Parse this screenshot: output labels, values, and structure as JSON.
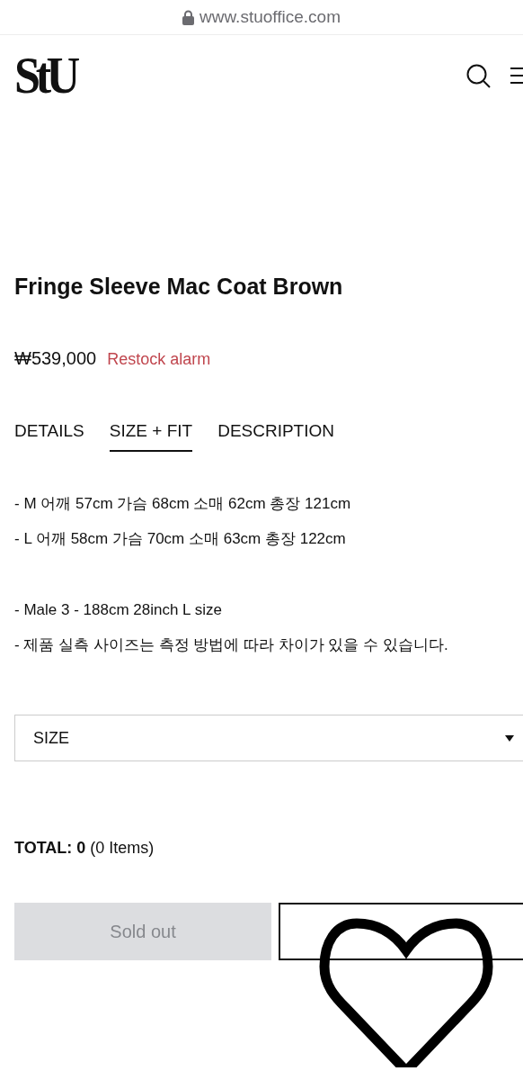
{
  "address_bar": {
    "url": "www.stuoffice.com"
  },
  "header": {
    "logo": "StU"
  },
  "product": {
    "title": "Fringe Sleeve Mac Coat Brown",
    "price": "₩539,000",
    "restock_link": "Restock alarm"
  },
  "tabs": [
    {
      "label": "DETAILS",
      "selected": false
    },
    {
      "label": "SIZE + FIT",
      "selected": true
    },
    {
      "label": "DESCRIPTION",
      "selected": false
    }
  ],
  "size_fit_paragraphs": [
    [
      "- M 어깨 57cm 가슴 68cm 소매 62cm 총장 121cm",
      "- L 어깨 58cm 가슴 70cm 소매 63cm 총장 122cm"
    ],
    [
      "- Male 3 - 188cm 28inch L size",
      "- 제품 실측 사이즈는 측정 방법에 따라 차이가 있을 수 있습니다."
    ]
  ],
  "size_select": {
    "placeholder": "SIZE"
  },
  "total": "**TOTAL: 0** (0 Items)",
  "buy_button": {
    "label": "Sold out",
    "disabled": true
  }
}
